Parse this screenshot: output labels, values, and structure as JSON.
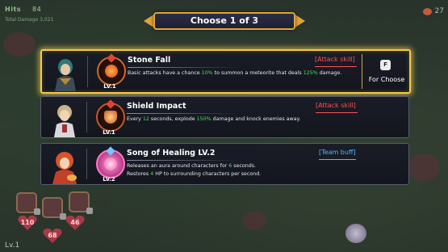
{
  "hud": {
    "hits_label": "Hits",
    "hits_value": "84",
    "total_damage": "Total Damage 3,021",
    "coins": "27",
    "player_level": "Lv.1"
  },
  "banner": {
    "title": "Choose 1 of 3"
  },
  "options": [
    {
      "name": "Stone Fall",
      "tag": "[Attack skill]",
      "level": "LV.1",
      "desc_parts": [
        "Basic attacks have a chance ",
        "10%",
        " to summon a meteorite that deals ",
        "125%",
        " damage."
      ],
      "selected": true,
      "key_hint": "F",
      "choose_label": "For Choose"
    },
    {
      "name": "Shield Impact",
      "tag": "[Attack skill]",
      "level": "LV.1",
      "desc_parts": [
        "Every ",
        "12",
        " seconds, explode ",
        "150%",
        " damage and knock enemies away."
      ],
      "selected": false
    },
    {
      "name": "Song of Healing LV.2",
      "tag": "[Team buff]",
      "level": "LV.2",
      "desc_line1_parts": [
        "Releases an aura around characters for ",
        "6",
        " seconds."
      ],
      "desc_line2_parts": [
        "Restores ",
        "4",
        " HP to surrounding characters per second."
      ],
      "selected": false
    }
  ],
  "party": {
    "hp_values": [
      "110",
      "68",
      "46"
    ]
  },
  "colors": {
    "gold": "#f2c94c",
    "attack_tag": "#ff5252",
    "team_tag": "#4fb8ff",
    "highlight_number": "#47e05a"
  }
}
